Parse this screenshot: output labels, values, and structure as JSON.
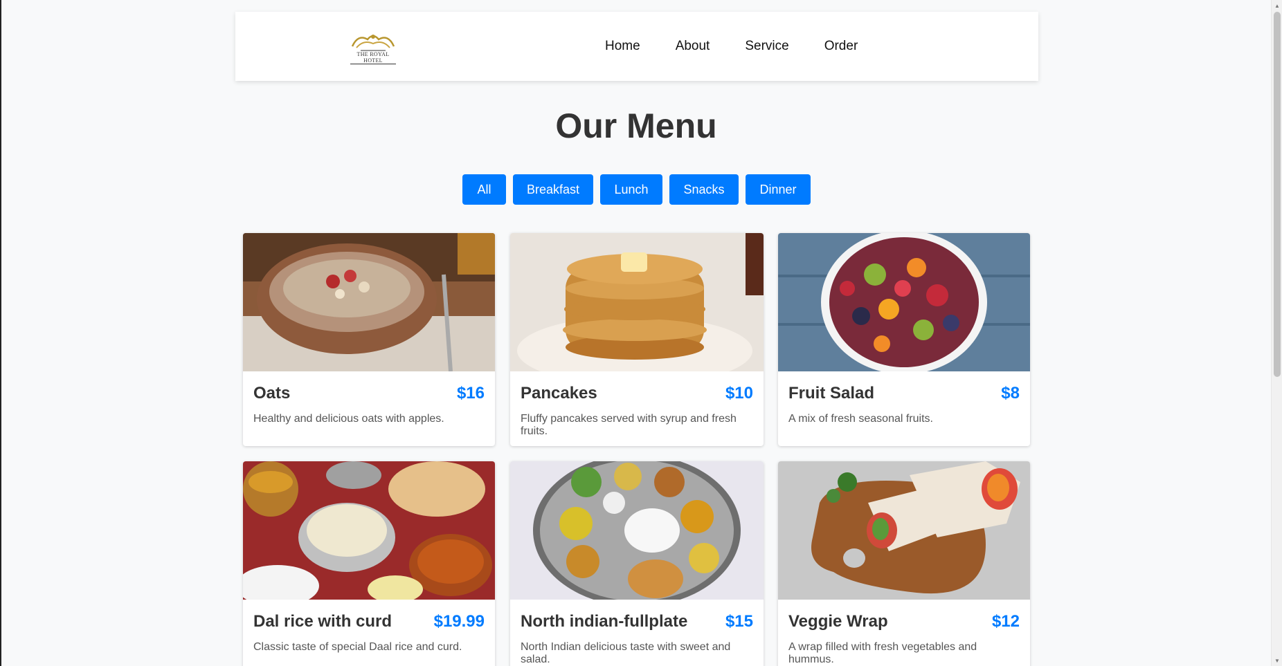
{
  "header": {
    "logo_text": "THE ROYAL HOTEL",
    "nav": [
      "Home",
      "About",
      "Service",
      "Order"
    ]
  },
  "page_title": "Our Menu",
  "filters": [
    "All",
    "Breakfast",
    "Lunch",
    "Snacks",
    "Dinner"
  ],
  "accent_color": "#007bff",
  "menu_items": [
    {
      "name": "Oats",
      "price": "$16",
      "description": "Healthy and delicious oats with apples.",
      "image": "oats-bowl-image"
    },
    {
      "name": "Pancakes",
      "price": "$10",
      "description": "Fluffy pancakes served with syrup and fresh fruits.",
      "image": "pancakes-stack-image"
    },
    {
      "name": "Fruit Salad",
      "price": "$8",
      "description": "A mix of fresh seasonal fruits.",
      "image": "fruit-salad-bowl-image"
    },
    {
      "name": "Dal rice with curd",
      "price": "$19.99",
      "description": "Classic taste of special Daal rice and curd.",
      "image": "dal-rice-spread-image"
    },
    {
      "name": "North indian-fullplate",
      "price": "$15",
      "description": "North Indian delicious taste with sweet and salad.",
      "image": "thali-plate-image"
    },
    {
      "name": "Veggie Wrap",
      "price": "$12",
      "description": "A wrap filled with fresh vegetables and hummus.",
      "image": "veggie-wrap-image"
    }
  ]
}
